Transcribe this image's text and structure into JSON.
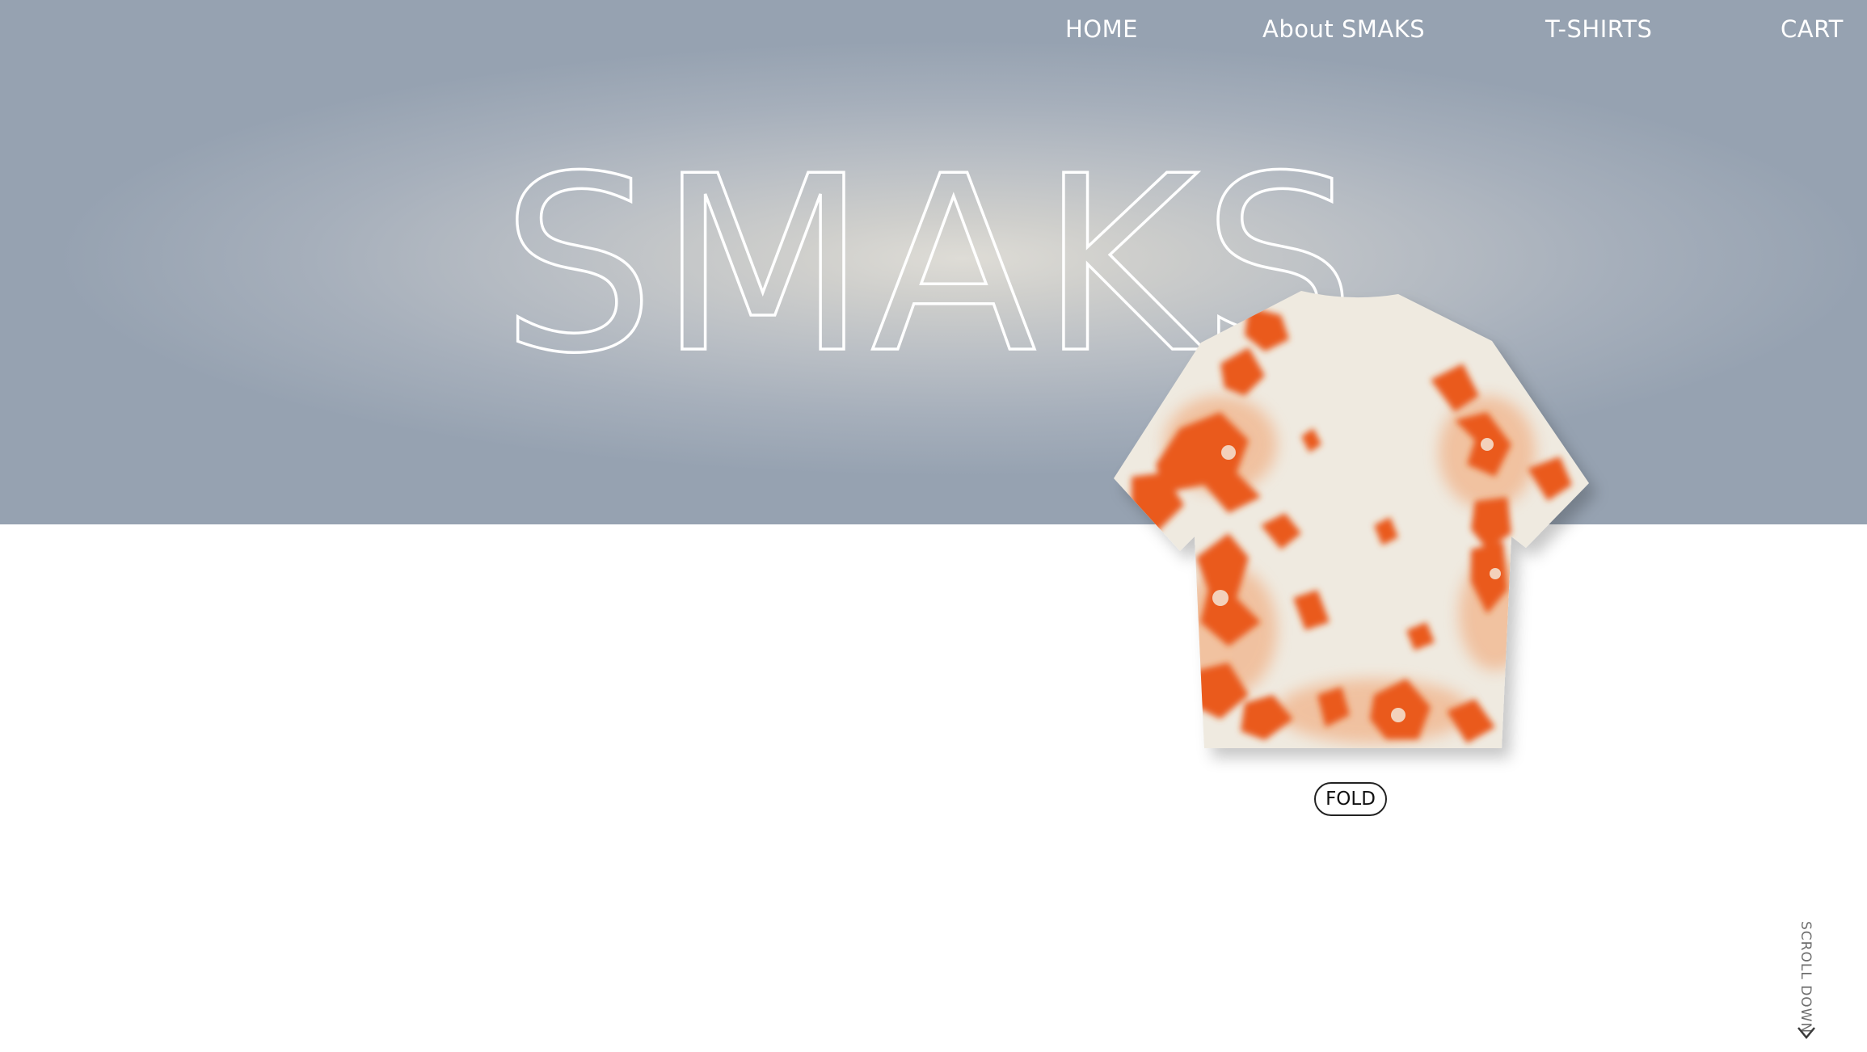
{
  "nav": {
    "home": "HOME",
    "about": "About SMAKS",
    "tshirts": "T-SHIRTS",
    "cart": "CART"
  },
  "hero": {
    "brand": "SMAKS"
  },
  "product": {
    "image_icon": "tie-dye-tshirt-image",
    "colors": {
      "base": "#efeae0",
      "dye": "#ea5a1a"
    },
    "fold_label": "FOLD"
  },
  "scroll": {
    "label": "SCROLL DOWN",
    "icon": "chevron-down-icon"
  },
  "colors": {
    "hero_center": "#dedcd6",
    "hero_edge": "#96a2b1",
    "nav_text": "#ffffff",
    "background": "#ffffff"
  }
}
